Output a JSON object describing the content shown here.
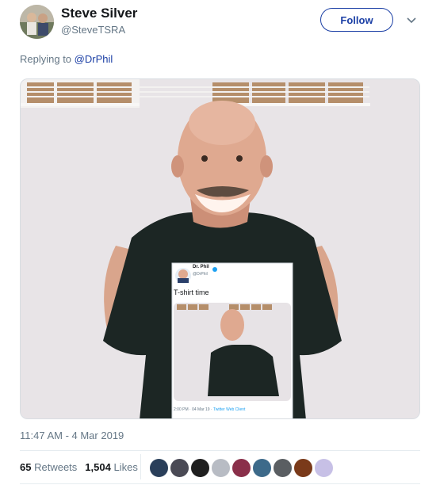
{
  "tweet": {
    "display_name": "Steve Silver",
    "handle": "@SteveTSRA",
    "follow_label": "Follow",
    "replying_prefix": "Replying to",
    "replying_mention": "@DrPhil",
    "timestamp": "11:47 AM - 4 Mar 2019",
    "retweets_count": "65",
    "retweets_label": "Retweets",
    "likes_count": "1,504",
    "likes_label": "Likes"
  },
  "embedded_tweet": {
    "name": "Dr. Phil",
    "handle": "@DrPhil",
    "text": "T-shirt time",
    "footer_time": "2:00 PM · 04 Mar 19 ·",
    "footer_client": "Twitter Web Client"
  },
  "icons": {
    "avatar": "profile-photo",
    "caret": "chevron-down-icon",
    "verified": "verified-badge-icon"
  },
  "colors": {
    "accent": "#1b3fa5",
    "muted": "#657786",
    "shirt": "#1c2624",
    "wall": "#e7e3e6"
  },
  "likers": [
    "#2a3f5a",
    "#4a4a55",
    "#1f1f1f",
    "#b8bcc4",
    "#8a2f4a",
    "#3d6a8a",
    "#5a5e62",
    "#7a3a1a",
    "#c7c0e6"
  ]
}
